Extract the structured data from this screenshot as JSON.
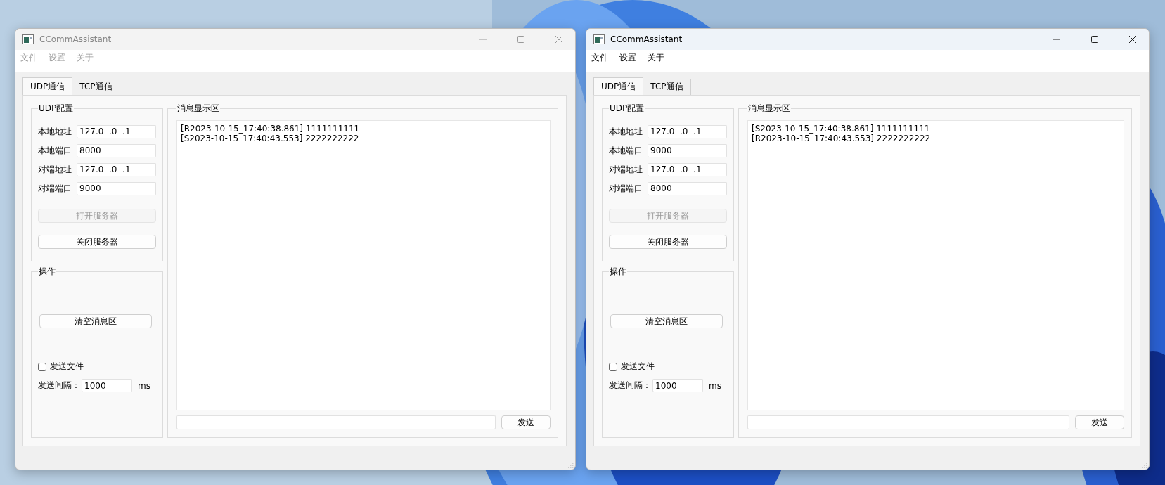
{
  "windows": [
    {
      "active": false,
      "title": "CCommAssistant",
      "menu": [
        "文件",
        "设置",
        "关于"
      ],
      "tabs": [
        {
          "label": "UDP通信",
          "selected": true
        },
        {
          "label": "TCP通信",
          "selected": false
        }
      ],
      "config": {
        "title": "UDP配置",
        "fields": [
          {
            "label": "本地地址",
            "value": "127.0  .0  .1"
          },
          {
            "label": "本地端口",
            "value": "8000"
          },
          {
            "label": "对端地址",
            "value": "127.0  .0  .1"
          },
          {
            "label": "对端端口",
            "value": "9000"
          }
        ],
        "buttons": [
          {
            "label": "打开服务器",
            "disabled": true
          },
          {
            "label": "关闭服务器",
            "disabled": false
          }
        ]
      },
      "operations": {
        "title": "操作",
        "clear_button": "清空消息区",
        "send_file": {
          "label": "发送文件",
          "checked": false
        },
        "interval": {
          "label": "发送间隔：",
          "value": "1000",
          "unit": "ms"
        }
      },
      "messages": {
        "title": "消息显示区",
        "lines": [
          "[R2023-10-15_17:40:38.861] 1111111111",
          "[S2023-10-15_17:40:43.553] 2222222222"
        ],
        "send_button": "发送"
      }
    },
    {
      "active": true,
      "title": "CCommAssistant",
      "menu": [
        "文件",
        "设置",
        "关于"
      ],
      "tabs": [
        {
          "label": "UDP通信",
          "selected": true
        },
        {
          "label": "TCP通信",
          "selected": false
        }
      ],
      "config": {
        "title": "UDP配置",
        "fields": [
          {
            "label": "本地地址",
            "value": "127.0  .0  .1"
          },
          {
            "label": "本地端口",
            "value": "9000"
          },
          {
            "label": "对端地址",
            "value": "127.0  .0  .1"
          },
          {
            "label": "对端端口",
            "value": "8000"
          }
        ],
        "buttons": [
          {
            "label": "打开服务器",
            "disabled": true
          },
          {
            "label": "关闭服务器",
            "disabled": false
          }
        ]
      },
      "operations": {
        "title": "操作",
        "clear_button": "清空消息区",
        "send_file": {
          "label": "发送文件",
          "checked": false
        },
        "interval": {
          "label": "发送间隔：",
          "value": "1000",
          "unit": "ms"
        }
      },
      "messages": {
        "title": "消息显示区",
        "lines": [
          "[S2023-10-15_17:40:38.861] 1111111111",
          "[R2023-10-15_17:40:43.553] 2222222222"
        ],
        "send_button": "发送"
      }
    }
  ]
}
